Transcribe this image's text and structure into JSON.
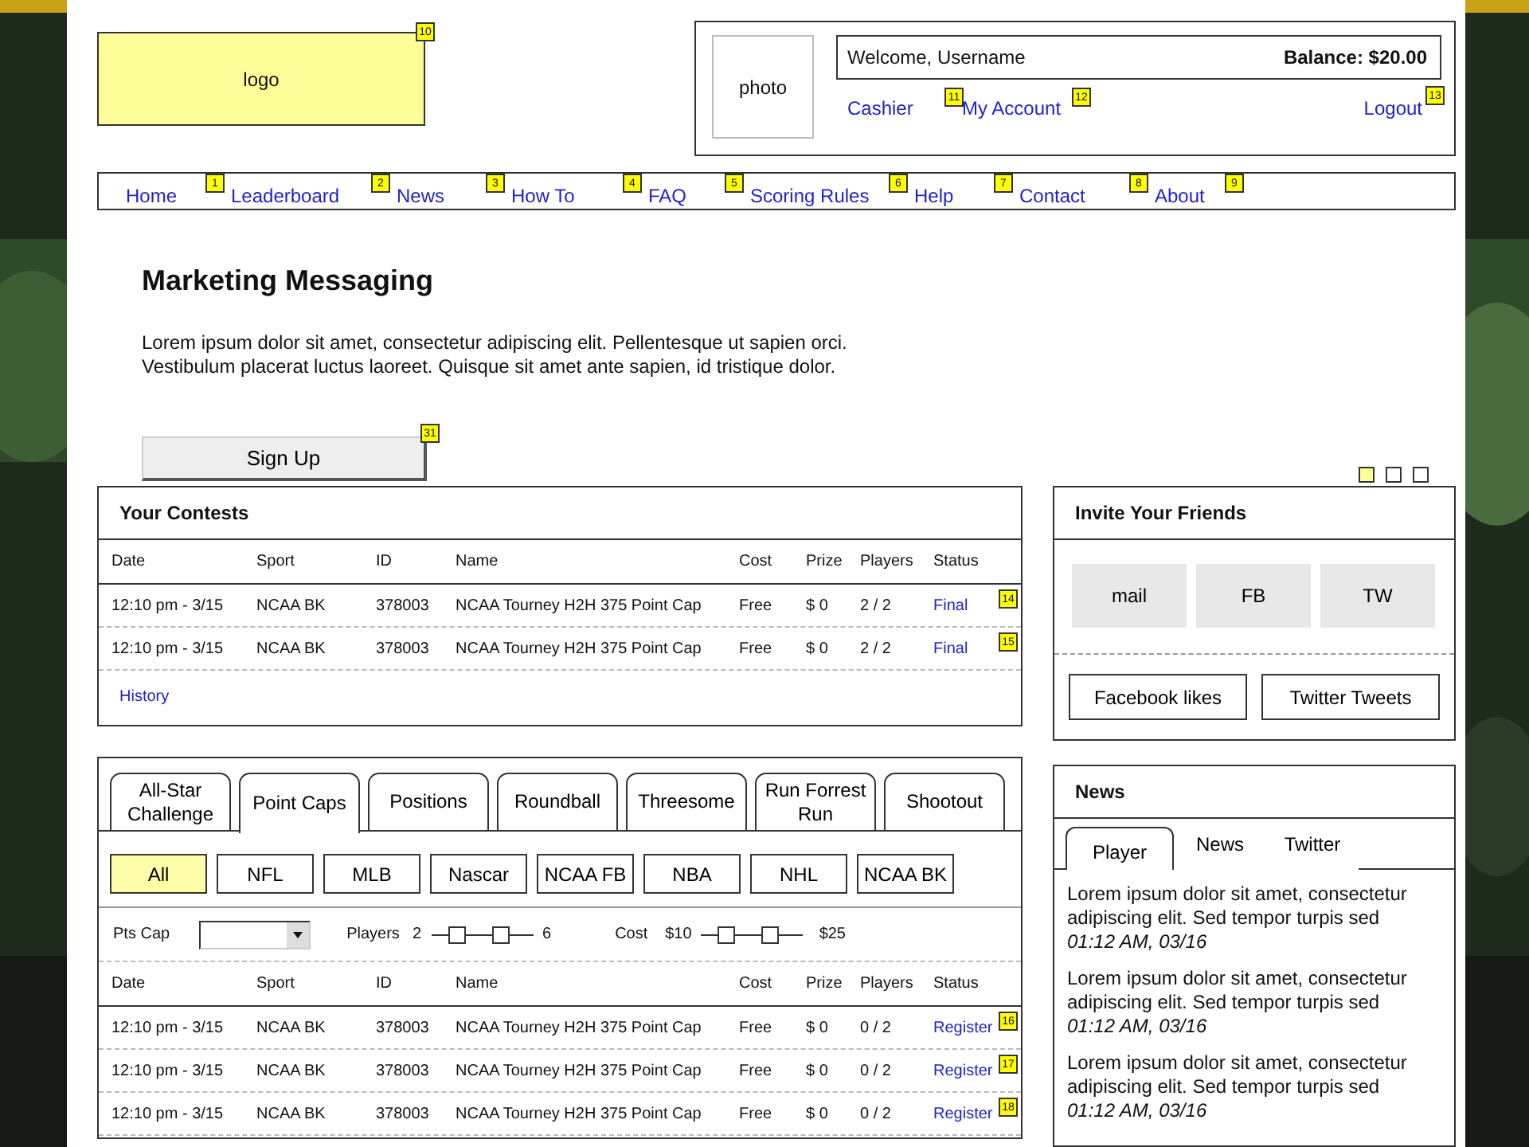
{
  "header": {
    "logo": {
      "label": "logo",
      "note": "10"
    },
    "account": {
      "photo": "photo",
      "welcome": "Welcome, Username",
      "balance": "Balance: $20.00",
      "links": [
        {
          "label": "Cashier",
          "note": "11"
        },
        {
          "label": "My Account",
          "note": "12"
        },
        {
          "label": "Logout",
          "note": "13"
        }
      ]
    }
  },
  "nav": [
    {
      "label": "Home",
      "note": "1"
    },
    {
      "label": "Leaderboard",
      "note": "2"
    },
    {
      "label": "News",
      "note": "3"
    },
    {
      "label": "How To",
      "note": "4"
    },
    {
      "label": "FAQ",
      "note": "5"
    },
    {
      "label": "Scoring Rules",
      "note": "6"
    },
    {
      "label": "Help",
      "note": "7"
    },
    {
      "label": "Contact",
      "note": "8"
    },
    {
      "label": "About",
      "note": "9"
    }
  ],
  "hero": {
    "title": "Marketing Messaging",
    "text": "Lorem ipsum dolor sit amet, consectetur adipiscing elit. Pellentesque ut sapien orci. Vestibulum placerat luctus laoreet. Quisque sit amet ante sapien, id tristique dolor.",
    "button": "Sign Up",
    "note": "31",
    "dots": [
      {
        "selected": true
      },
      {
        "selected": false
      },
      {
        "selected": false
      }
    ]
  },
  "your_contests": {
    "title": "Your Contests",
    "columns": [
      "Date",
      "Sport",
      "ID",
      "Name",
      "Cost",
      "Prize",
      "Players",
      "Status"
    ],
    "rows": [
      {
        "cells": [
          "12:10 pm - 3/15",
          "NCAA BK",
          "378003",
          "NCAA Tourney H2H 375 Point Cap",
          "Free",
          "$ 0",
          "2 / 2",
          "Final"
        ],
        "note": "14"
      },
      {
        "cells": [
          "12:10 pm - 3/15",
          "NCAA BK",
          "378003",
          "NCAA Tourney H2H 375 Point Cap",
          "Free",
          "$ 0",
          "2 / 2",
          "Final"
        ],
        "note": "15"
      }
    ],
    "link": "History"
  },
  "lobby": {
    "tabs": [
      {
        "label": "All-Star Challenge",
        "selected": false
      },
      {
        "label": "Point Caps",
        "selected": true
      },
      {
        "label": "Positions",
        "selected": false
      },
      {
        "label": "Roundball",
        "selected": false
      },
      {
        "label": "Threesome",
        "selected": false
      },
      {
        "label": "Run Forrest Run",
        "selected": false
      },
      {
        "label": "Shootout",
        "selected": false
      }
    ],
    "sports": [
      {
        "label": "All",
        "selected": true
      },
      {
        "label": "NFL",
        "selected": false
      },
      {
        "label": "MLB",
        "selected": false
      },
      {
        "label": "Nascar",
        "selected": false
      },
      {
        "label": "NCAA FB",
        "selected": false
      },
      {
        "label": "NBA",
        "selected": false
      },
      {
        "label": "NHL",
        "selected": false
      },
      {
        "label": "NCAA BK",
        "selected": false
      }
    ],
    "filters": {
      "pts_cap": "Pts Cap",
      "players": {
        "label": "Players",
        "min": "2",
        "max": "6",
        "thumbs": [
          {
            "level": 0.25
          },
          {
            "level": 0.68
          }
        ]
      },
      "cost": {
        "label": "Cost",
        "min": "$10",
        "max": "$25",
        "thumbs": [
          {
            "level": 0.25
          },
          {
            "level": 0.68
          }
        ]
      }
    },
    "columns": [
      "Date",
      "Sport",
      "ID",
      "Name",
      "Cost",
      "Prize",
      "Players",
      "Status"
    ],
    "rows": [
      {
        "cells": [
          "12:10 pm - 3/15",
          "NCAA BK",
          "378003",
          "NCAA Tourney H2H 375 Point Cap",
          "Free",
          "$ 0",
          "0 / 2",
          "Register"
        ],
        "note": "16"
      },
      {
        "cells": [
          "12:10 pm - 3/15",
          "NCAA BK",
          "378003",
          "NCAA Tourney H2H 375 Point Cap",
          "Free",
          "$ 0",
          "0 / 2",
          "Register"
        ],
        "note": "17"
      },
      {
        "cells": [
          "12:10 pm - 3/15",
          "NCAA BK",
          "378003",
          "NCAA Tourney H2H 375 Point Cap",
          "Free",
          "$ 0",
          "0 / 2",
          "Register"
        ],
        "note": "18"
      }
    ]
  },
  "invite": {
    "title": "Invite Your Friends",
    "share": [
      "mail",
      "FB",
      "TW"
    ],
    "buttons": [
      "Facebook likes",
      "Twitter Tweets"
    ]
  },
  "news": {
    "title": "News",
    "tabs": [
      {
        "label": "Player",
        "selected": true
      },
      {
        "label": "News",
        "selected": false
      },
      {
        "label": "Twitter",
        "selected": false
      }
    ],
    "items": [
      {
        "text": "Lorem ipsum dolor sit amet, consectetur adipiscing elit. Sed tempor turpis sed",
        "time": "01:12 AM, 03/16"
      },
      {
        "text": "Lorem ipsum dolor sit amet, consectetur adipiscing elit. Sed tempor turpis sed",
        "time": "01:12 AM, 03/16"
      },
      {
        "text": "Lorem ipsum dolor sit amet, consectetur adipiscing elit. Sed tempor turpis sed",
        "time": "01:12 AM, 03/16"
      }
    ]
  }
}
